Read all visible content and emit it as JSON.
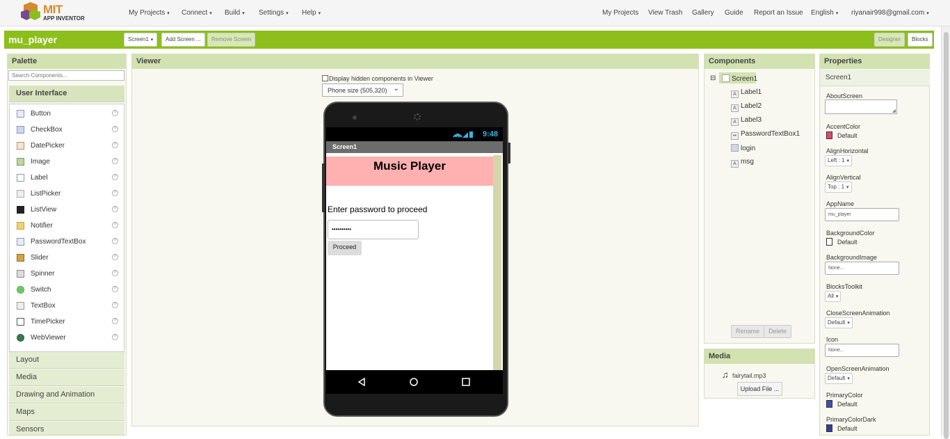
{
  "nav": {
    "logo_top": "MIT",
    "logo_bottom": "APP INVENTOR",
    "menu_left": [
      "My Projects",
      "Connect",
      "Build",
      "Settings",
      "Help"
    ],
    "menu_right": [
      "My Projects",
      "View Trash",
      "Gallery",
      "Guide",
      "Report an Issue",
      "English",
      "riyanair998@gmail.com"
    ]
  },
  "project": {
    "title": "mu_player",
    "screen_select": "Screen1",
    "add_screen": "Add Screen ...",
    "remove_screen": "Remove Screen",
    "designer": "Designer",
    "blocks": "Blocks"
  },
  "palette": {
    "header": "Palette",
    "search_placeholder": "Search Components...",
    "open_category": "User Interface",
    "components": [
      "Button",
      "CheckBox",
      "DatePicker",
      "Image",
      "Label",
      "ListPicker",
      "ListView",
      "Notifier",
      "PasswordTextBox",
      "Slider",
      "Spinner",
      "Switch",
      "TextBox",
      "TimePicker",
      "WebViewer"
    ],
    "help_glyph": "?",
    "categories": [
      "Layout",
      "Media",
      "Drawing and Animation",
      "Maps",
      "Sensors"
    ]
  },
  "viewer": {
    "header": "Viewer",
    "hidden_checkbox_label": "Display hidden components in Viewer",
    "phone_size": "Phone size (505,320)",
    "status_time": "9:48",
    "screen_title": "Screen1",
    "app_title": "Music Player",
    "prompt": "Enter password to proceed",
    "password_value": "••••••••••",
    "proceed": "Proceed"
  },
  "components": {
    "header": "Components",
    "root": "Screen1",
    "collapse_glyph": "⊟",
    "items": [
      {
        "name": "Label1",
        "icon": "label-icon",
        "glyph": "A"
      },
      {
        "name": "Label2",
        "icon": "label-icon",
        "glyph": "A"
      },
      {
        "name": "Label3",
        "icon": "label-icon",
        "glyph": "A"
      },
      {
        "name": "PasswordTextBox1",
        "icon": "password-icon",
        "glyph": "••"
      },
      {
        "name": "login",
        "icon": "button-icon",
        "glyph": ""
      },
      {
        "name": "msg",
        "icon": "label-icon",
        "glyph": "A"
      }
    ],
    "rename": "Rename",
    "delete": "Delete"
  },
  "media": {
    "header": "Media",
    "file": "fairytail.mp3",
    "upload": "Upload File ..."
  },
  "properties": {
    "header": "Properties",
    "target": "Screen1",
    "about_label": "AboutScreen",
    "accent_label": "AccentColor",
    "accent_value": "Default",
    "accent_color": "#e8466a",
    "alignh_label": "AlignHorizontal",
    "alignh_value": "Left : 1",
    "alignv_label": "AlignVertical",
    "alignv_value": "Top : 1",
    "appname_label": "AppName",
    "appname_value": "mu_player",
    "bgcolor_label": "BackgroundColor",
    "bgcolor_value": "Default",
    "bgcolor_color": "#ffffff",
    "bgimage_label": "BackgroundImage",
    "bgimage_value": "None...",
    "toolkit_label": "BlocksToolkit",
    "toolkit_value": "All",
    "close_anim_label": "CloseScreenAnimation",
    "close_anim_value": "Default",
    "icon_label": "Icon",
    "icon_value": "None...",
    "open_anim_label": "OpenScreenAnimation",
    "open_anim_value": "Default",
    "primary_label": "PrimaryColor",
    "primary_value": "Default",
    "primary_color": "#3f51b5",
    "primary_dark_label": "PrimaryColorDark",
    "primary_dark_value": "Default",
    "primary_dark_color": "#303f9f"
  }
}
